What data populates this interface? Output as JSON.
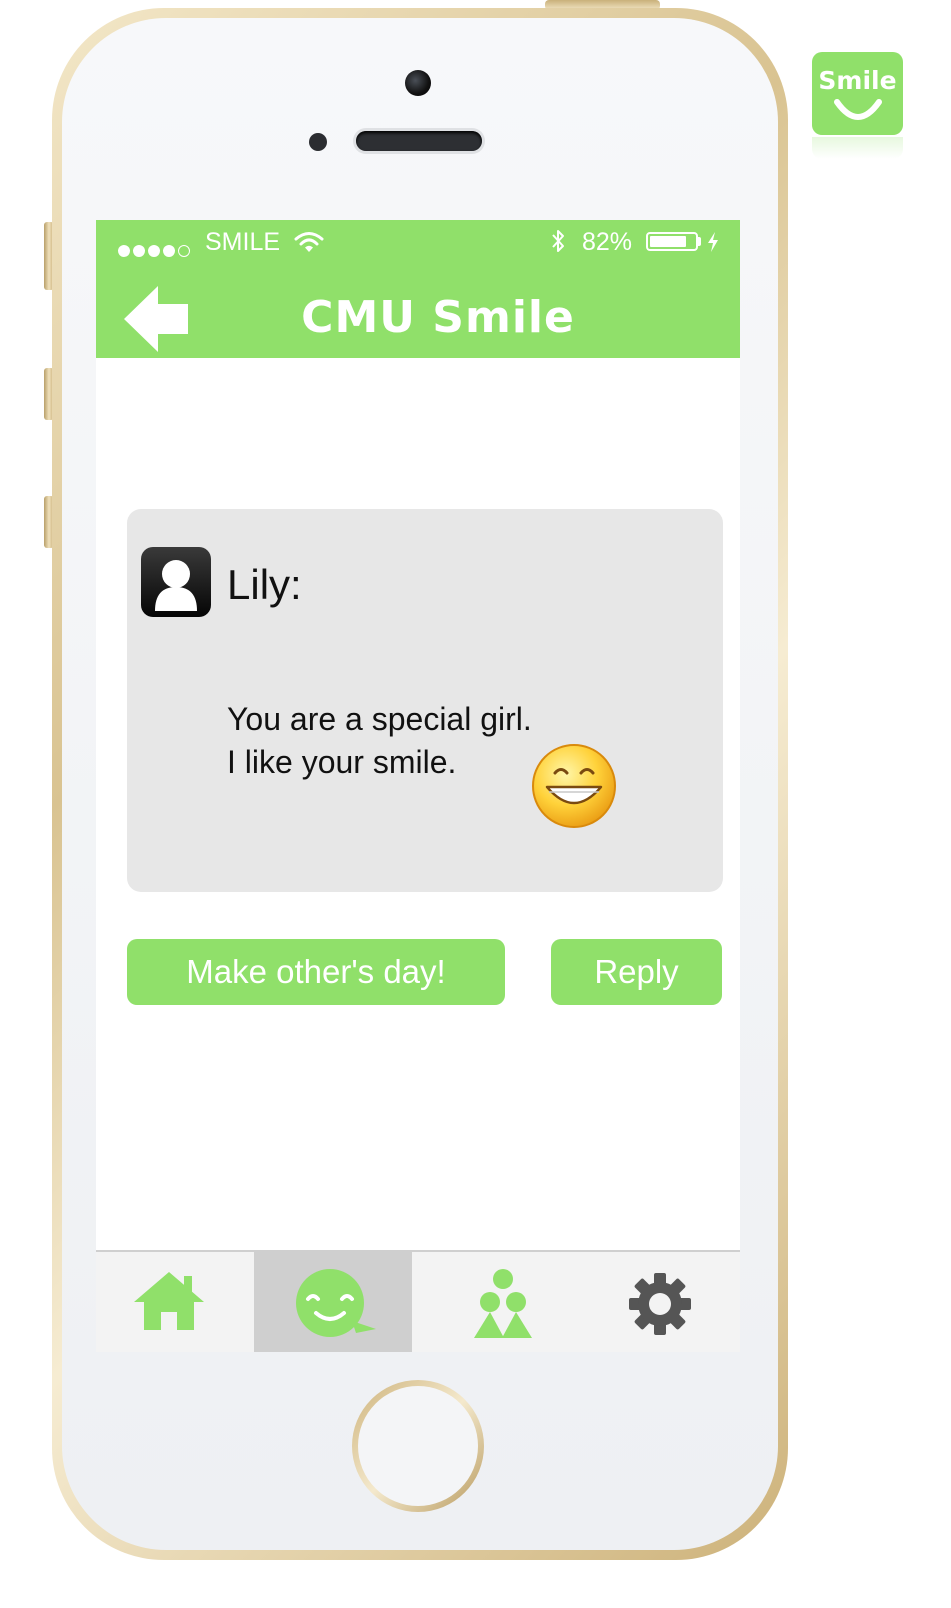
{
  "app_logo": {
    "text": "Smile"
  },
  "status_bar": {
    "signal_bars_filled": 4,
    "signal_bars_total": 5,
    "carrier": "SMILE",
    "battery_text": "82%",
    "battery_level": 0.82
  },
  "nav_bar": {
    "title": "CMU Smile",
    "back_icon": "back-arrow-icon"
  },
  "message": {
    "sender": "Lily:",
    "lines": [
      "You are a special girl.",
      "I like your smile."
    ],
    "emoji": "grinning-face-icon"
  },
  "actions": {
    "make_day_label": "Make other's day!",
    "reply_label": "Reply"
  },
  "tab_bar": {
    "tabs": [
      {
        "icon": "home-icon",
        "active": false
      },
      {
        "icon": "smile-chat-icon",
        "active": true
      },
      {
        "icon": "people-icon",
        "active": false
      },
      {
        "icon": "gear-icon",
        "active": false
      }
    ]
  },
  "colors": {
    "accent": "#90e06a",
    "card_bg": "#e7e7e7",
    "tab_active_bg": "#cfcfcf",
    "gear": "#555555"
  }
}
